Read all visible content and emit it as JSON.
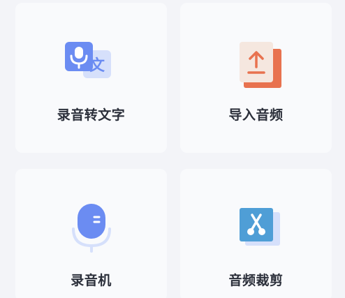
{
  "tools": [
    {
      "label": "录音转文字",
      "icon": "speech-to-text-icon"
    },
    {
      "label": "导入音频",
      "icon": "import-audio-icon"
    },
    {
      "label": "录音机",
      "icon": "microphone-icon"
    },
    {
      "label": "音频裁剪",
      "icon": "scissors-icon"
    }
  ],
  "colors": {
    "primary_blue": "#6b8cf2",
    "light_blue": "#d6e0fb",
    "import_bg": "#f5e7df",
    "import_accent": "#e8724f",
    "scissors_blue": "#4f9ed6",
    "label_text": "#2b2f3a"
  }
}
